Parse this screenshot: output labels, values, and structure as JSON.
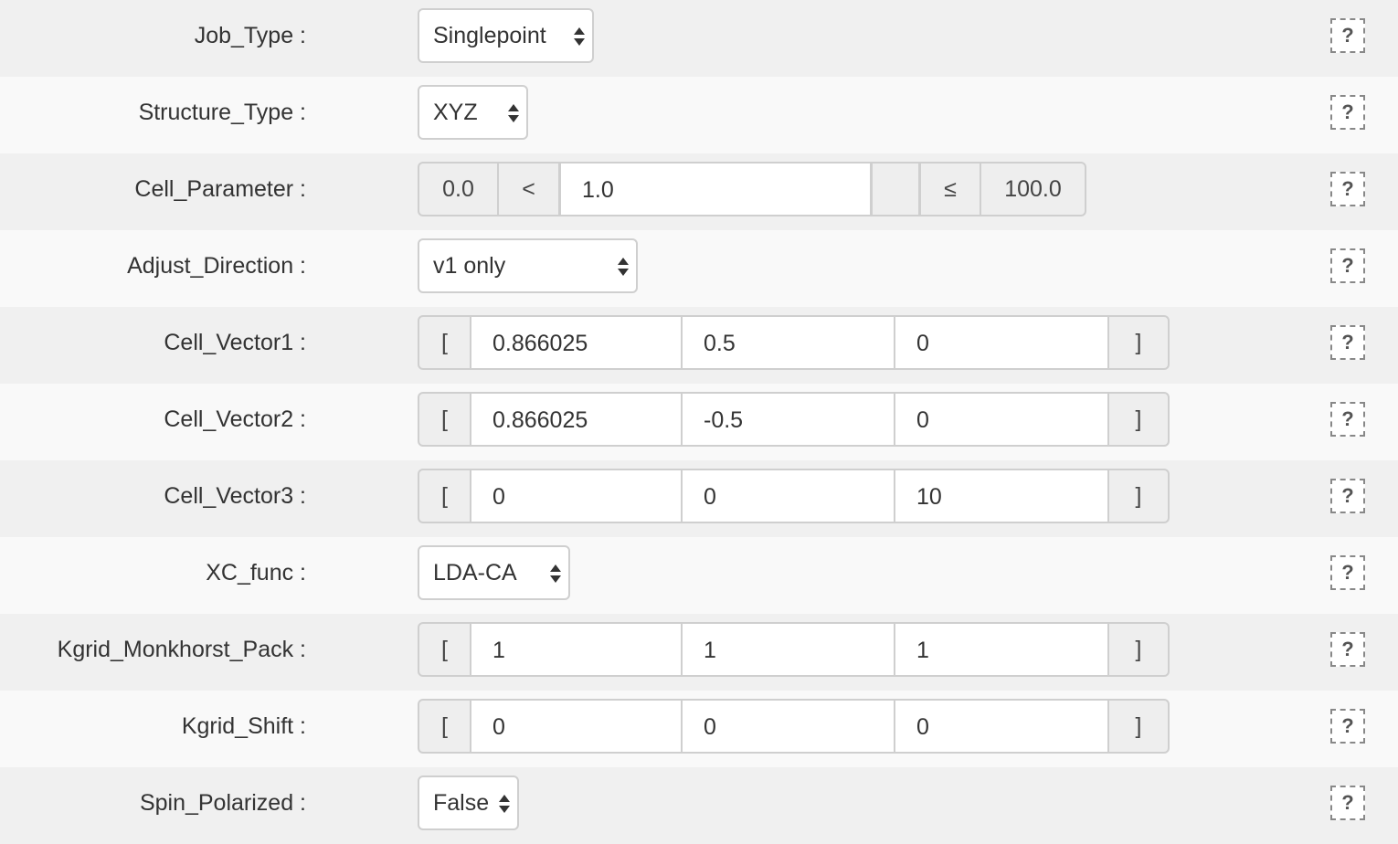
{
  "help_glyph": "?",
  "rows": [
    {
      "label": "Job_Type :",
      "value": "Singlepoint"
    },
    {
      "label": "Structure_Type :",
      "value": "XYZ"
    },
    {
      "label": "Cell_Parameter :",
      "min": "0.0",
      "op1": "<",
      "value": "1.0",
      "op2": "≤",
      "max": "100.0"
    },
    {
      "label": "Adjust_Direction :",
      "value": "v1 only"
    },
    {
      "label": "Cell_Vector1 :",
      "open": "[",
      "v": [
        "0.866025",
        "0.5",
        "0"
      ],
      "close": "]"
    },
    {
      "label": "Cell_Vector2 :",
      "open": "[",
      "v": [
        "0.866025",
        "-0.5",
        "0"
      ],
      "close": "]"
    },
    {
      "label": "Cell_Vector3 :",
      "open": "[",
      "v": [
        "0",
        "0",
        "10"
      ],
      "close": "]"
    },
    {
      "label": "XC_func :",
      "value": "LDA-CA"
    },
    {
      "label": "Kgrid_Monkhorst_Pack :",
      "open": "[",
      "v": [
        "1",
        "1",
        "1"
      ],
      "close": "]"
    },
    {
      "label": "Kgrid_Shift :",
      "open": "[",
      "v": [
        "0",
        "0",
        "0"
      ],
      "close": "]"
    },
    {
      "label": "Spin_Polarized :",
      "value": "False"
    }
  ]
}
